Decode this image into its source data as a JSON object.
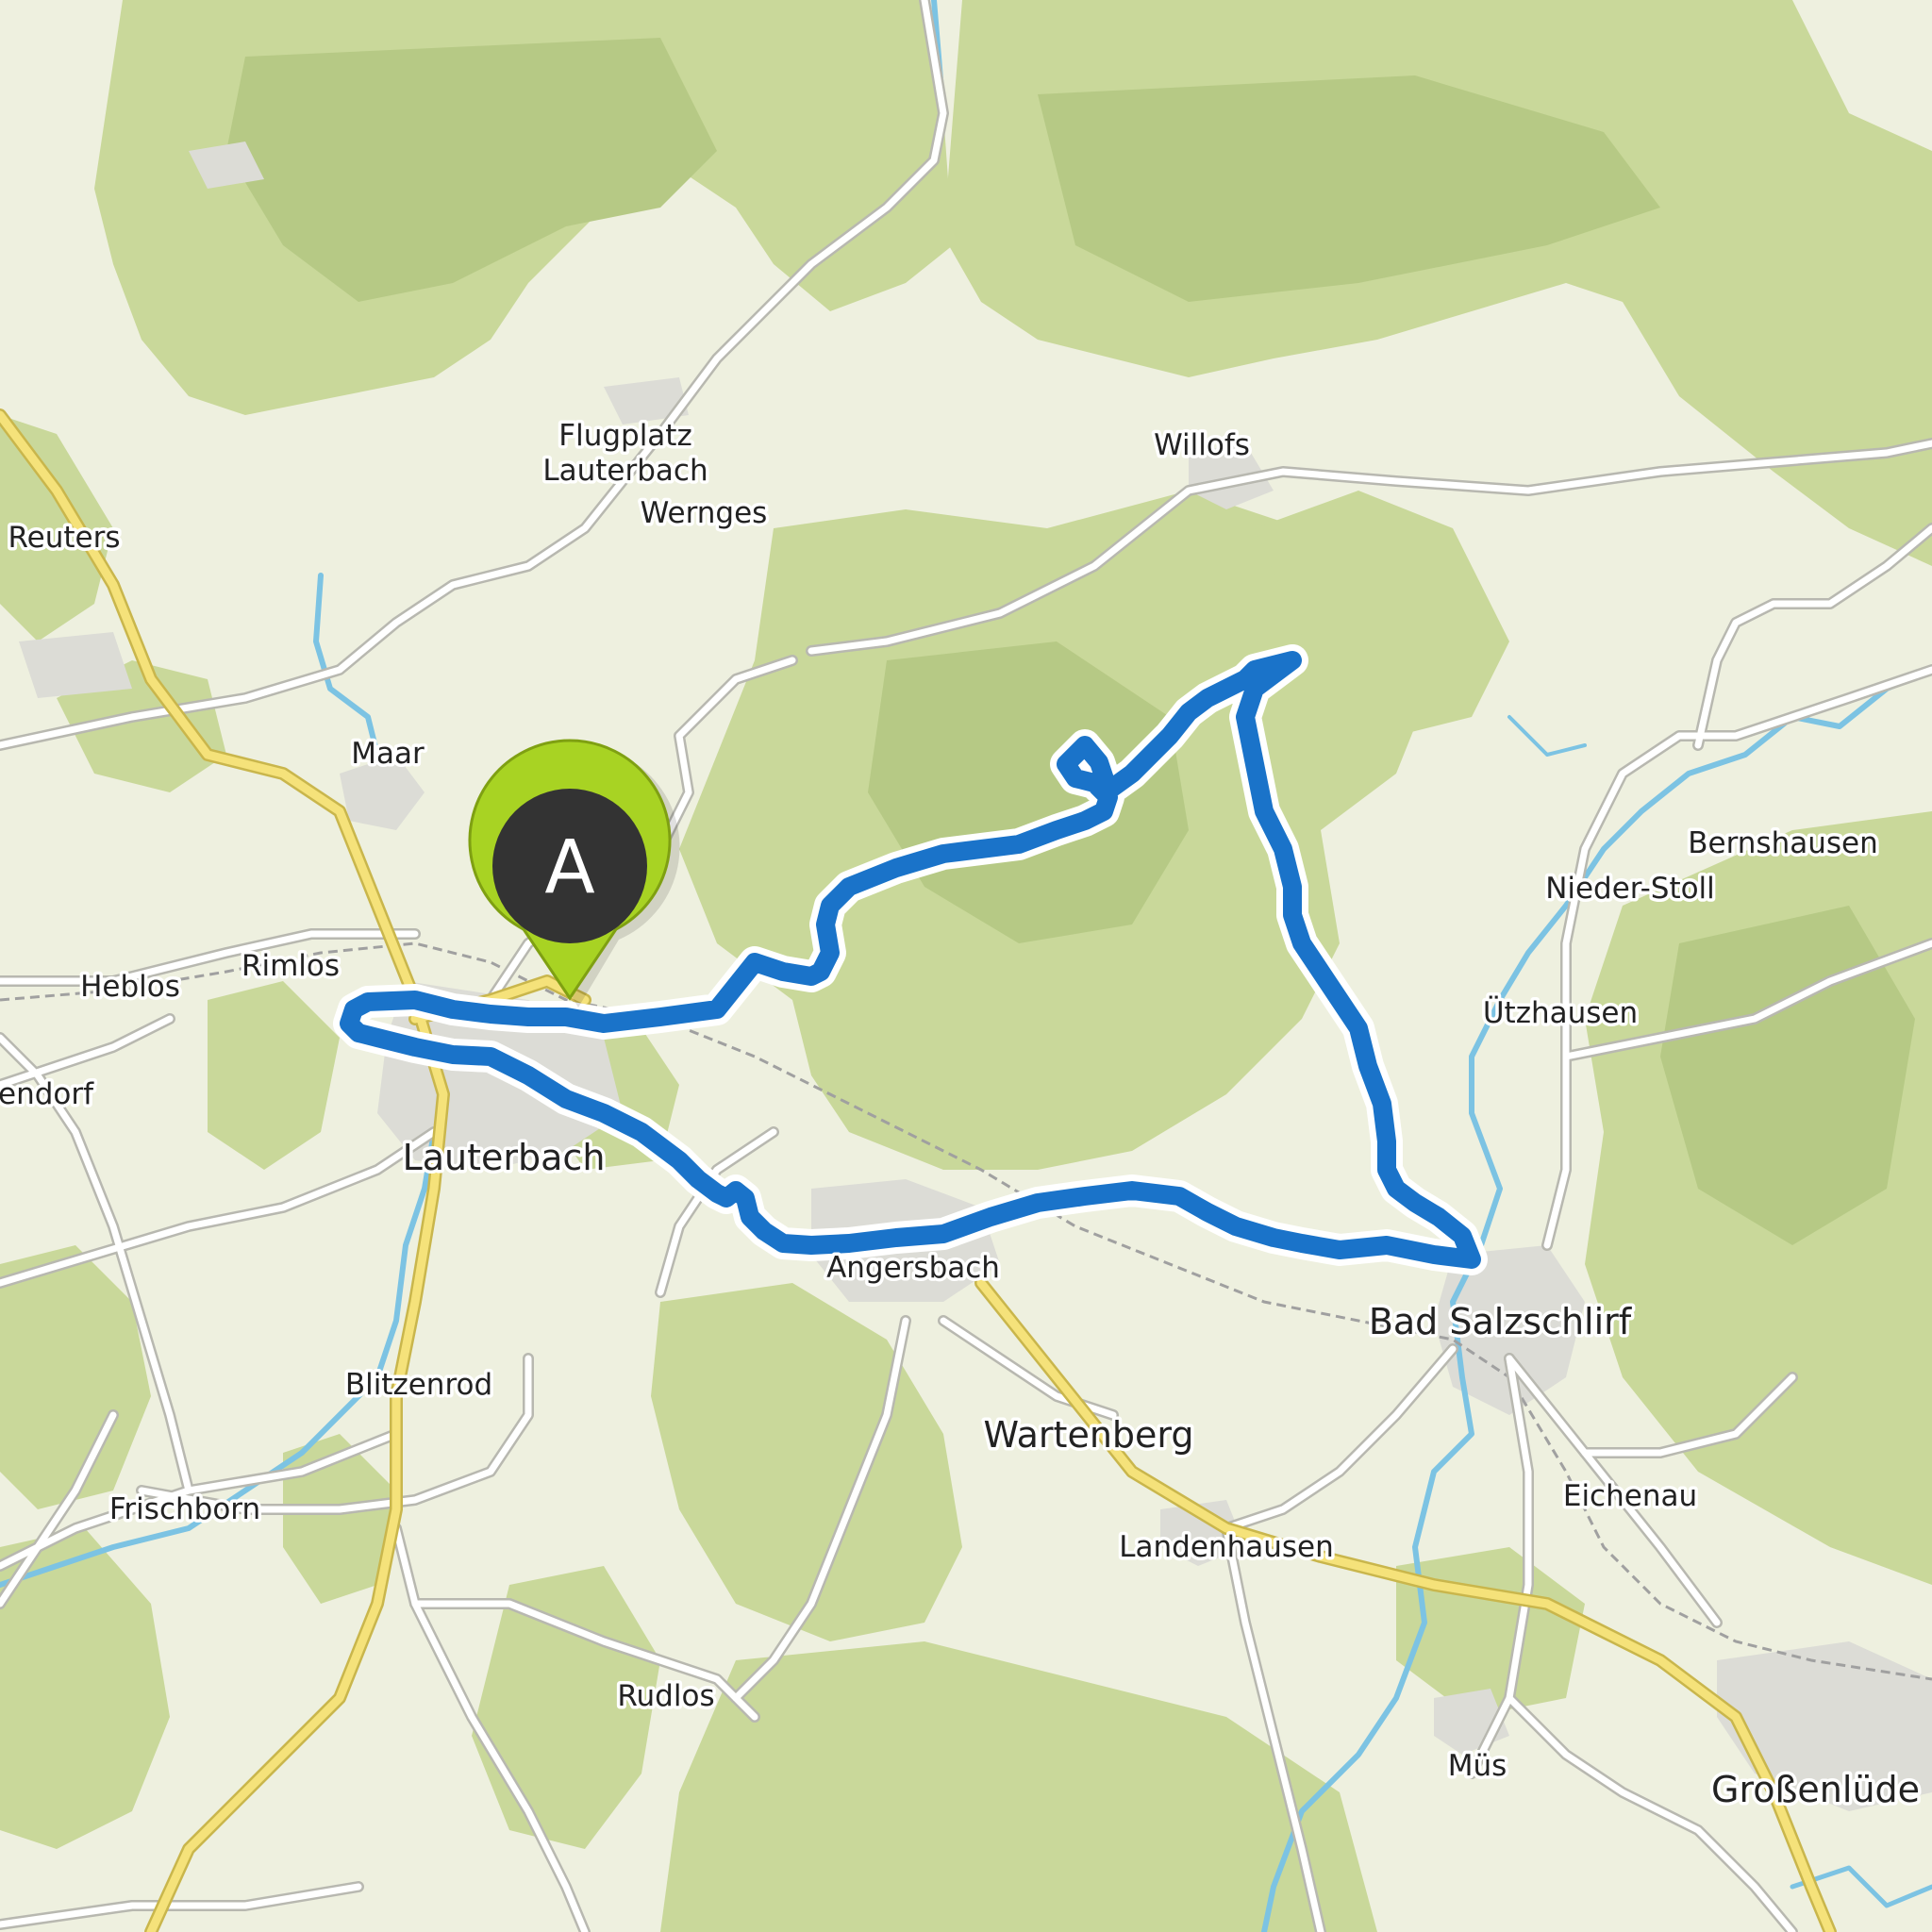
{
  "map": {
    "colors": {
      "land": "#eef0df",
      "forest": "#c9d89a",
      "forest_dark": "#b6c985",
      "settlement": "#dcdcd6",
      "road": "#ffffff",
      "road_casing": "#b8b8b0",
      "main_road": "#f5e27a",
      "main_road_casing": "#c9b64c",
      "water": "#7cc3e3",
      "railway": "#a0a0a0",
      "route": "#1a73c9",
      "route_outline": "#ffffff",
      "marker": "#a8d323",
      "marker_inner": "#333333"
    },
    "start_marker": {
      "label": "A",
      "icon": "map-pin-icon"
    },
    "places": [
      {
        "id": "flugplatz-1",
        "name": "Flugplatz"
      },
      {
        "id": "flugplatz-2",
        "name": "Lauterbach"
      },
      {
        "id": "wernges",
        "name": "Wernges"
      },
      {
        "id": "willofs",
        "name": "Willofs"
      },
      {
        "id": "reuters",
        "name": "Reuters"
      },
      {
        "id": "maar",
        "name": "Maar"
      },
      {
        "id": "heblos",
        "name": "Heblos"
      },
      {
        "id": "rimlos",
        "name": "Rimlos"
      },
      {
        "id": "endorf",
        "name": "endorf"
      },
      {
        "id": "lauterbach",
        "name": "Lauterbach"
      },
      {
        "id": "angersbach",
        "name": "Angersbach"
      },
      {
        "id": "bernshausen",
        "name": "Bernshausen"
      },
      {
        "id": "nieder-stoll",
        "name": "Nieder-Stoll"
      },
      {
        "id": "utzhausen",
        "name": "Ützhausen"
      },
      {
        "id": "bad-salzschlirf",
        "name": "Bad Salzschlirf"
      },
      {
        "id": "blitzenrod",
        "name": "Blitzenrod"
      },
      {
        "id": "wartenberg",
        "name": "Wartenberg"
      },
      {
        "id": "frischborn",
        "name": "Frischborn"
      },
      {
        "id": "eichenau",
        "name": "Eichenau"
      },
      {
        "id": "landenhausen",
        "name": "Landenhausen"
      },
      {
        "id": "rudlos",
        "name": "Rudlos"
      },
      {
        "id": "mus",
        "name": "Müs"
      },
      {
        "id": "grossenluder",
        "name": "Großenlüde"
      }
    ]
  }
}
